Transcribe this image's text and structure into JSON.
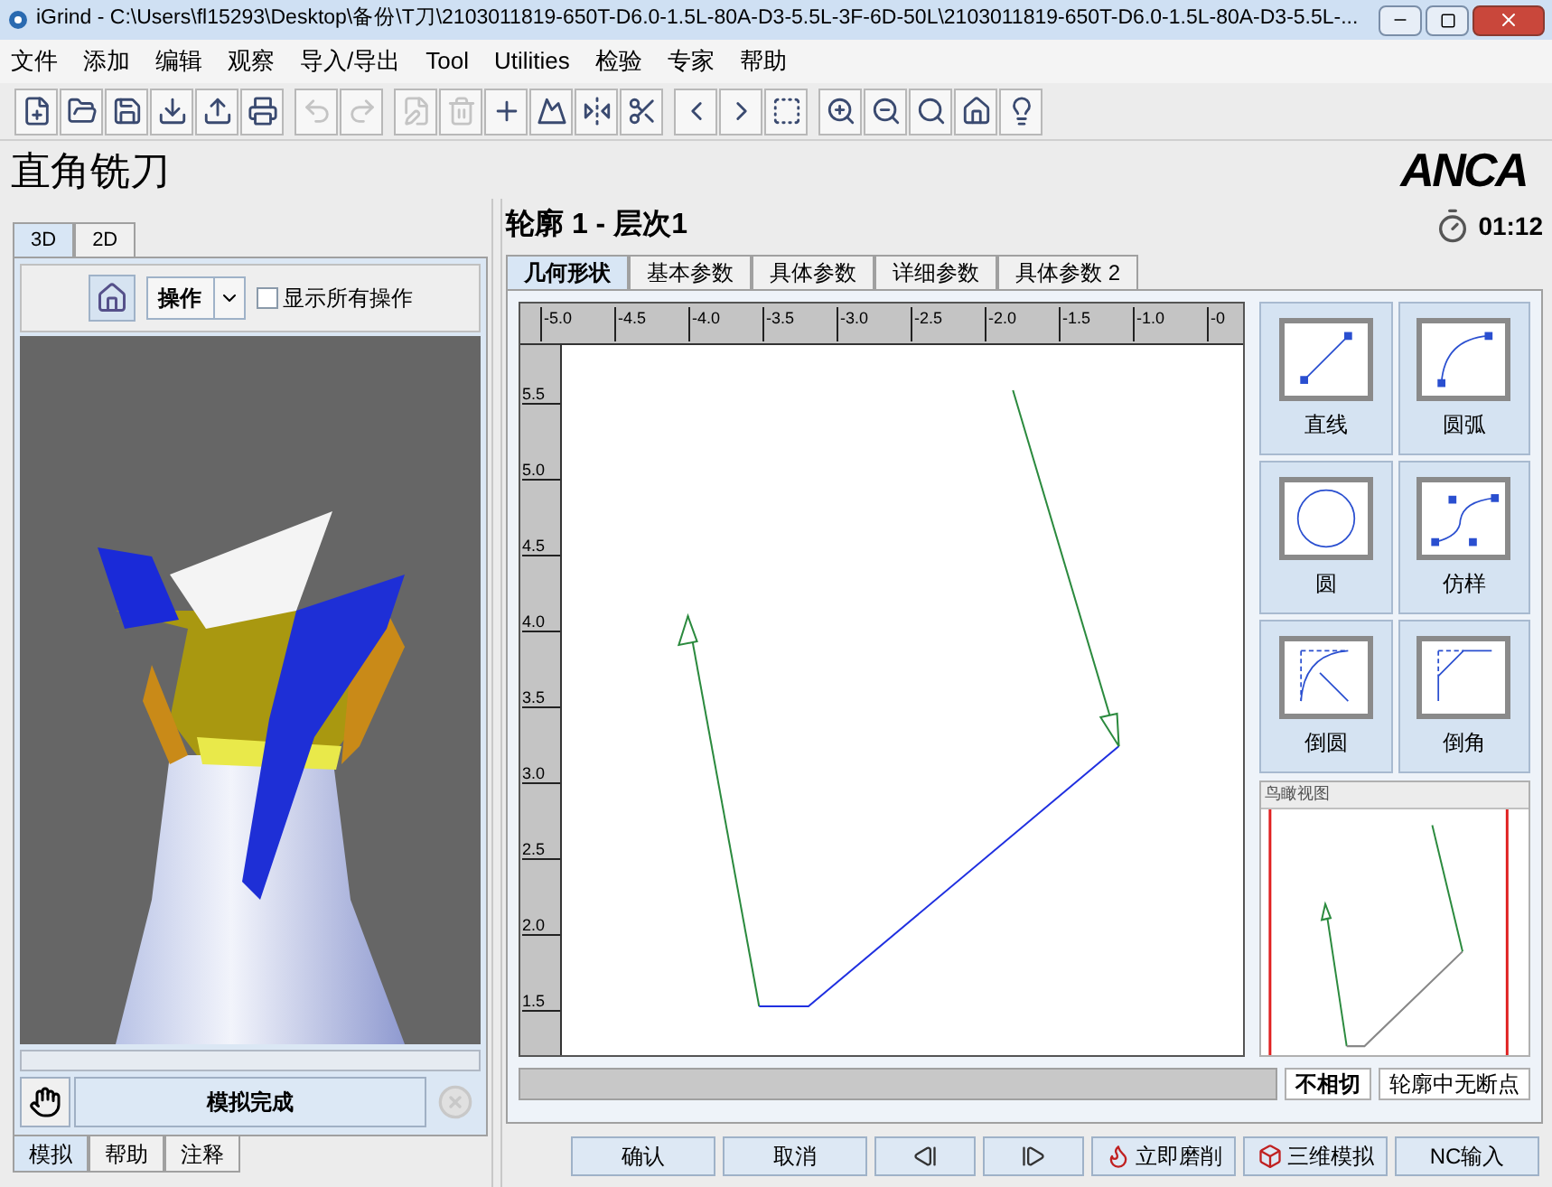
{
  "window": {
    "title": "iGrind - C:\\Users\\fl15293\\Desktop\\备份\\T刀\\2103011819-650T-D6.0-1.5L-80A-D3-5.5L-3F-6D-50L\\2103011819-650T-D6.0-1.5L-80A-D3-5.5L-..."
  },
  "menu": [
    "文件",
    "添加",
    "编辑",
    "观察",
    "导入/导出",
    "Tool",
    "Utilities",
    "检验",
    "专家",
    "帮助"
  ],
  "toolbar_groups": [
    [
      {
        "disabled": false
      },
      {
        "disabled": false
      },
      {
        "disabled": false
      },
      {
        "disabled": false
      },
      {
        "disabled": false
      },
      {
        "disabled": false
      }
    ],
    [
      {
        "disabled": true
      },
      {
        "disabled": true
      }
    ],
    [
      {
        "disabled": true
      },
      {
        "disabled": true
      },
      {
        "disabled": false
      },
      {
        "disabled": false
      },
      {
        "disabled": false
      },
      {
        "disabled": false
      }
    ],
    [
      {
        "disabled": false
      },
      {
        "disabled": false
      },
      {
        "disabled": false
      }
    ],
    [
      {
        "disabled": false
      },
      {
        "disabled": false
      },
      {
        "disabled": false
      },
      {
        "disabled": false
      },
      {
        "disabled": false
      }
    ]
  ],
  "page_title": "直角铣刀",
  "logo": "ANCA",
  "left_panel": {
    "view_tabs": [
      {
        "label": "3D",
        "selected": true
      },
      {
        "label": "2D",
        "selected": false
      }
    ],
    "operation_select": {
      "value": "操作"
    },
    "show_all": {
      "label": "显示所有操作",
      "checked": false
    },
    "simulate_button": "模拟完成",
    "simulation_progress": {
      "level": 0
    },
    "bottom_tabs": [
      {
        "label": "模拟",
        "selected": true
      },
      {
        "label": "帮助",
        "selected": false
      },
      {
        "label": "注释",
        "selected": false
      }
    ]
  },
  "profile": {
    "title": "轮廓 1 - 层次1",
    "timer": "01:12",
    "tabs": [
      {
        "label": "几何形状",
        "selected": true
      },
      {
        "label": "基本参数",
        "selected": false
      },
      {
        "label": "具体参数",
        "selected": false
      },
      {
        "label": "详细参数",
        "selected": false
      },
      {
        "label": "具体参数 2",
        "selected": false
      }
    ],
    "x_ruler": [
      "-5.0",
      "-4.5",
      "-4.0",
      "-3.5",
      "-3.0",
      "-2.5",
      "-2.0",
      "-1.5",
      "-1.0",
      "-0"
    ],
    "y_ruler": [
      "5.5",
      "5.0",
      "4.5",
      "4.0",
      "3.5",
      "3.0",
      "2.5",
      "2.0",
      "1.5"
    ],
    "palette": [
      "直线",
      "圆弧",
      "圆",
      "仿样",
      "倒圆",
      "倒角"
    ],
    "overview_title": "鸟瞰视图",
    "progress": {
      "level": 0
    },
    "status": [
      "不相切",
      "轮廓中无断点"
    ]
  },
  "buttons": [
    {
      "kind": "text",
      "label": "确认"
    },
    {
      "kind": "text",
      "label": "取消"
    },
    {
      "kind": "icon"
    },
    {
      "kind": "icon"
    },
    {
      "kind": "icon_text",
      "label": "立即磨削"
    },
    {
      "kind": "icon_text",
      "label": "三维模拟"
    },
    {
      "kind": "text",
      "label": "NC输入"
    }
  ]
}
